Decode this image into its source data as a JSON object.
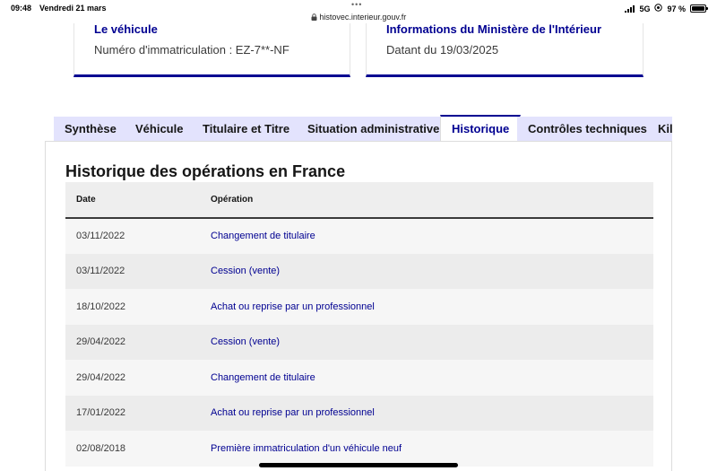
{
  "status_bar": {
    "time": "09:48",
    "date": "Vendredi 21 mars",
    "url": "histovec.interieur.gouv.fr",
    "network": "5G",
    "battery": "97 %"
  },
  "cards": [
    {
      "title": "Le véhicule",
      "text": "Numéro d'immatriculation : EZ-7**-NF"
    },
    {
      "title": "Informations du Ministère de l'Intérieur",
      "text": "Datant du 19/03/2025"
    }
  ],
  "tabs": [
    {
      "label": "Synthèse",
      "active": false
    },
    {
      "label": "Véhicule",
      "active": false
    },
    {
      "label": "Titulaire et Titre",
      "active": false
    },
    {
      "label": "Situation administrative",
      "active": false
    },
    {
      "label": "Historique",
      "active": true
    },
    {
      "label": "Contrôles techniques",
      "active": false
    },
    {
      "label": "Kilométrage",
      "active": false
    }
  ],
  "history": {
    "title": "Historique des opérations en France",
    "columns": {
      "date": "Date",
      "operation": "Opération"
    },
    "rows": [
      {
        "date": "03/11/2022",
        "operation": "Changement de titulaire"
      },
      {
        "date": "03/11/2022",
        "operation": "Cession (vente)"
      },
      {
        "date": "18/10/2022",
        "operation": "Achat ou reprise par un professionnel"
      },
      {
        "date": "29/04/2022",
        "operation": "Cession (vente)"
      },
      {
        "date": "29/04/2022",
        "operation": "Changement de titulaire"
      },
      {
        "date": "17/01/2022",
        "operation": "Achat ou reprise par un professionnel"
      },
      {
        "date": "02/08/2018",
        "operation": "Première immatriculation d'un véhicule neuf"
      }
    ]
  },
  "colors": {
    "accent": "#000091",
    "tab_inactive": "#e3e3fd",
    "row_odd": "#f6f6f6",
    "row_even": "#ececec"
  }
}
